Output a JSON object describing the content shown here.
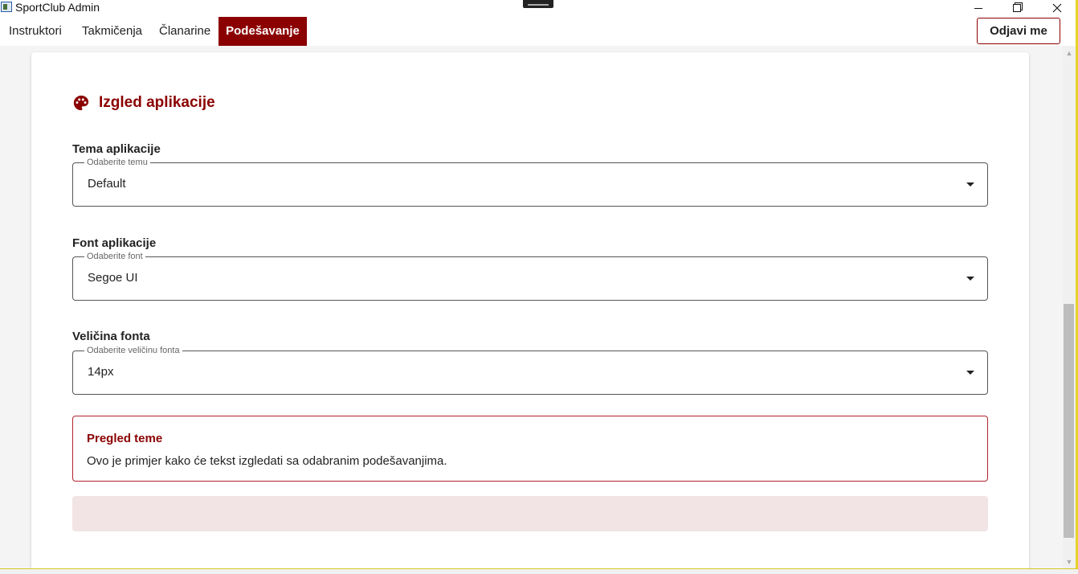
{
  "window": {
    "title": "SportClub Admin",
    "minimize_icon": "minimize-icon",
    "maximize_icon": "restore-icon",
    "close_icon": "close-icon"
  },
  "nav": {
    "tabs": [
      {
        "label": "Instruktori",
        "active": false
      },
      {
        "label": "Takmičenja",
        "active": false
      },
      {
        "label": "Članarine",
        "active": false
      },
      {
        "label": "Podešavanje",
        "active": true
      }
    ],
    "logout_label": "Odjavi me"
  },
  "colors": {
    "accent": "#8b0000",
    "preview_border": "#b0242c",
    "preview_fill": "#f2e4e4"
  },
  "settings": {
    "section_title": "Izgled aplikacije",
    "section_icon": "palette-icon",
    "theme": {
      "label": "Tema aplikacije",
      "placeholder": "Odaberite temu",
      "value": "Default"
    },
    "font": {
      "label": "Font aplikacije",
      "placeholder": "Odaberite font",
      "value": "Segoe UI"
    },
    "font_size": {
      "label": "Veličina fonta",
      "placeholder": "Odaberite veličinu fonta",
      "value": "14px"
    },
    "preview": {
      "title": "Pregled teme",
      "text": "Ovo je primjer kako će tekst izgledati sa odabranim podešavanjima."
    }
  }
}
